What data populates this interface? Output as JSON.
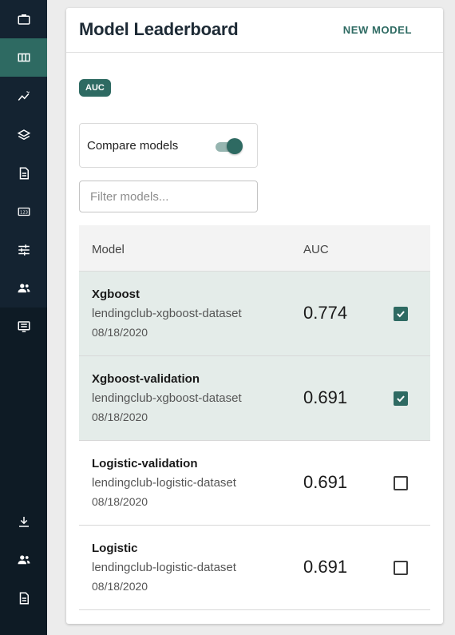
{
  "sidebar": {
    "items": [
      {
        "icon": "briefcase-icon"
      },
      {
        "icon": "columns-icon",
        "active": true
      },
      {
        "icon": "chart-line-icon"
      },
      {
        "icon": "layers-icon"
      },
      {
        "icon": "document-icon"
      },
      {
        "icon": "numbers-icon"
      },
      {
        "icon": "sliders-icon"
      },
      {
        "icon": "users-icon"
      },
      {
        "icon": "monitor-list-icon"
      }
    ],
    "bottom_items": [
      {
        "icon": "download-icon"
      },
      {
        "icon": "users-icon"
      },
      {
        "icon": "document-icon"
      }
    ]
  },
  "header": {
    "title": "Model Leaderboard",
    "new_model_label": "NEW MODEL"
  },
  "metric_chip": "AUC",
  "compare": {
    "label": "Compare models",
    "enabled": true
  },
  "filter": {
    "placeholder": "Filter models...",
    "value": ""
  },
  "table": {
    "columns": [
      "Model",
      "AUC"
    ],
    "rows": [
      {
        "name": "Xgboost",
        "dataset": "lendingclub-xgboost-dataset",
        "date": "08/18/2020",
        "auc": "0.774",
        "selected": true
      },
      {
        "name": "Xgboost-validation",
        "dataset": "lendingclub-xgboost-dataset",
        "date": "08/18/2020",
        "auc": "0.691",
        "selected": true
      },
      {
        "name": "Logistic-validation",
        "dataset": "lendingclub-logistic-dataset",
        "date": "08/18/2020",
        "auc": "0.691",
        "selected": false
      },
      {
        "name": "Logistic",
        "dataset": "lendingclub-logistic-dataset",
        "date": "08/18/2020",
        "auc": "0.691",
        "selected": false
      }
    ]
  },
  "colors": {
    "accent": "#2e6a62",
    "sidebar_bg": "#142331",
    "selected_row": "#e4ece9"
  }
}
